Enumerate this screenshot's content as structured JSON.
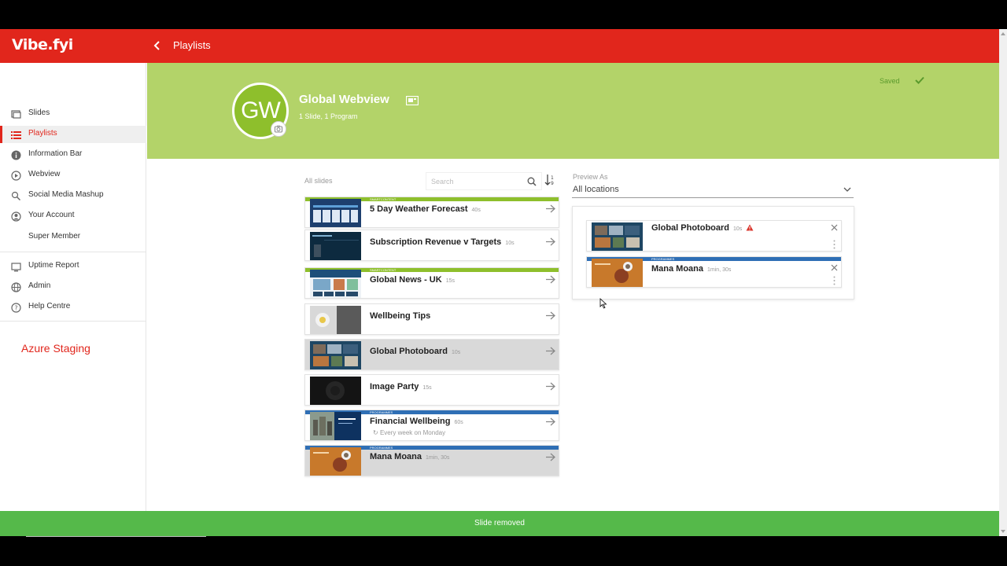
{
  "app": {
    "logo": "Vibe.fyi"
  },
  "header": {
    "breadcrumb": "Playlists"
  },
  "sidebar": {
    "items": [
      {
        "label": "Slides",
        "icon": "slides-icon"
      },
      {
        "label": "Playlists",
        "icon": "list-icon",
        "active": true
      },
      {
        "label": "Information Bar",
        "icon": "info-icon"
      },
      {
        "label": "Webview",
        "icon": "play-circle-icon"
      },
      {
        "label": "Social Media Mashup",
        "icon": "social-icon"
      },
      {
        "label": "Your Account",
        "icon": "user-icon"
      },
      {
        "label": "Super Member",
        "icon": ""
      },
      {
        "label": "Uptime Report",
        "icon": "report-icon"
      },
      {
        "label": "Admin",
        "icon": "globe-icon"
      },
      {
        "label": "Help Centre",
        "icon": "help-icon"
      }
    ],
    "environment": "Azure Staging"
  },
  "playlist": {
    "initials": "GW",
    "title": "Global Webview",
    "subtitle": "1 Slide, 1 Program",
    "status": "Saved"
  },
  "slides": {
    "heading": "All slides",
    "search_placeholder": "Search",
    "items": [
      {
        "title": "5 Day Weather Forecast",
        "duration": "40s",
        "band": "SMARTCONTENT",
        "band_color": "#8ebf2c",
        "thumb": "weather"
      },
      {
        "title": "Subscription Revenue v Targets",
        "duration": "10s",
        "band": "",
        "band_color": "",
        "thumb": "revenue"
      },
      {
        "title": "Global News - UK",
        "duration": "15s",
        "band": "SMARTCONTENT",
        "band_color": "#8ebf2c",
        "thumb": "news"
      },
      {
        "title": "Wellbeing Tips",
        "duration": "",
        "band": "",
        "band_color": "",
        "thumb": "wellbeing"
      },
      {
        "title": "Global Photoboard",
        "duration": "10s",
        "band": "",
        "band_color": "",
        "thumb": "photoboard",
        "highlighted": true
      },
      {
        "title": "Image Party",
        "duration": "15s",
        "band": "",
        "band_color": "",
        "thumb": "party"
      },
      {
        "title": "Financial Wellbeing",
        "duration": "60s",
        "band": "PROGRAMMES",
        "band_color": "#2f6fb5",
        "thumb": "financial",
        "schedule": "Every week on Monday"
      },
      {
        "title": "Mana Moana",
        "duration": "1min, 30s",
        "band": "PROGRAMMES",
        "band_color": "#2f6fb5",
        "thumb": "mana",
        "highlighted": true
      }
    ]
  },
  "preview": {
    "label": "Preview As",
    "location": "All locations",
    "items": [
      {
        "title": "Global Photoboard",
        "duration": "10s",
        "warning": true,
        "band": "",
        "thumb": "photoboard"
      },
      {
        "title": "Mana Moana",
        "duration": "1min, 30s",
        "warning": false,
        "band": "PROGRAMMES",
        "band_color": "#2f6fb5",
        "thumb": "mana"
      }
    ]
  },
  "toast": {
    "message": "Slide removed"
  },
  "colors": {
    "brand": "#e1261c",
    "hero": "#b3d369",
    "toast": "#55b94a",
    "program": "#2f6fb5",
    "smart": "#8ebf2c"
  }
}
